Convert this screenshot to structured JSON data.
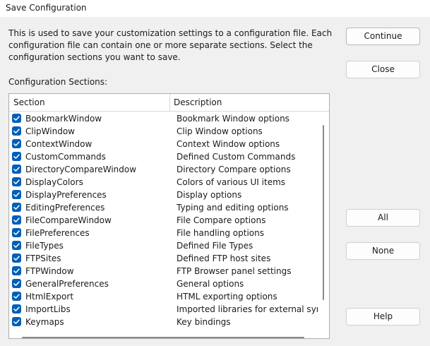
{
  "window": {
    "title": "Save Configuration"
  },
  "description": "This is used to save your customization settings to a configuration file. Each configuration file can contain one or more separate sections. Select the configuration sections you want to save.",
  "sections_label": "Configuration Sections:",
  "table": {
    "headers": {
      "section": "Section",
      "description": "Description"
    },
    "rows": [
      {
        "section": "BookmarkWindow",
        "description": "Bookmark Window options",
        "checked": true
      },
      {
        "section": "ClipWindow",
        "description": "Clip Window options",
        "checked": true
      },
      {
        "section": "ContextWindow",
        "description": "Context Window options",
        "checked": true
      },
      {
        "section": "CustomCommands",
        "description": "Defined Custom Commands",
        "checked": true
      },
      {
        "section": "DirectoryCompareWindow",
        "description": "Directory Compare options",
        "checked": true
      },
      {
        "section": "DisplayColors",
        "description": "Colors of various UI items",
        "checked": true
      },
      {
        "section": "DisplayPreferences",
        "description": "Display options",
        "checked": true
      },
      {
        "section": "EditingPreferences",
        "description": "Typing and editing options",
        "checked": true
      },
      {
        "section": "FileCompareWindow",
        "description": "File Compare options",
        "checked": true
      },
      {
        "section": "FilePreferences",
        "description": "File handling options",
        "checked": true
      },
      {
        "section": "FileTypes",
        "description": "Defined File Types",
        "checked": true
      },
      {
        "section": "FTPSites",
        "description": "Defined FTP host sites",
        "checked": true
      },
      {
        "section": "FTPWindow",
        "description": "FTP Browser panel settings",
        "checked": true
      },
      {
        "section": "GeneralPreferences",
        "description": "General options",
        "checked": true
      },
      {
        "section": "HtmlExport",
        "description": "HTML exporting options",
        "checked": true
      },
      {
        "section": "ImportLibs",
        "description": "Imported libraries for external sym",
        "checked": true
      },
      {
        "section": "Keymaps",
        "description": "Key bindings",
        "checked": true
      }
    ]
  },
  "buttons": {
    "continue": "Continue",
    "close": "Close",
    "all": "All",
    "none": "None",
    "help": "Help"
  },
  "colors": {
    "checkbox": "#005fb8",
    "background": "#f0f0f0"
  }
}
